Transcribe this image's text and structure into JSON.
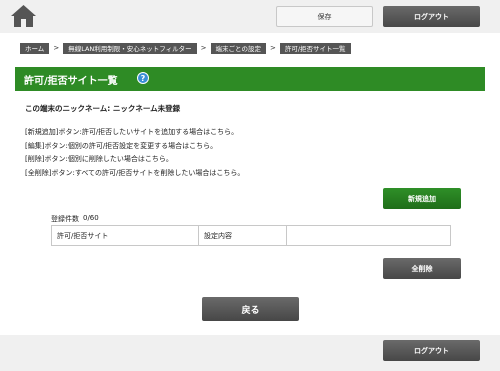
{
  "header": {
    "home_icon": "home-icon",
    "save_label": "保存",
    "logout_label": "ログアウト"
  },
  "breadcrumb": {
    "separator": ">",
    "items": [
      {
        "label": "ホーム"
      },
      {
        "label": "無線LAN利用制限・安心ネットフィルター"
      },
      {
        "label": "端末ごとの設定"
      },
      {
        "label": "許可/拒否サイト一覧"
      }
    ]
  },
  "page": {
    "title": "許可/拒否サイト一覧",
    "help_icon": "question-icon",
    "help_glyph": "?",
    "nickname_label": "この端末のニックネーム:",
    "nickname_value": "ニックネーム未登録",
    "help_lines": [
      "[新規追加]ボタン:許可/拒否したいサイトを追加する場合はこちら。",
      "[編集]ボタン:個別の許可/拒否設定を変更する場合はこちら。",
      "[削除]ボタン:個別に削除したい場合はこちら。",
      "[全削除]ボタン:すべての許可/拒否サイトを削除したい場合はこちら。"
    ],
    "add_button_label": "新規追加",
    "count_label": "登録件数",
    "count_value": "0/60",
    "table": {
      "columns": [
        "許可/拒否サイト",
        "設定内容",
        ""
      ]
    },
    "delete_all_label": "全削除",
    "back_label": "戻る"
  },
  "footer": {
    "logout_label": "ログアウト"
  },
  "colors": {
    "accent_green": "#2e8b25",
    "dark_button": "#555555",
    "help_blue": "#3a8fd6"
  }
}
